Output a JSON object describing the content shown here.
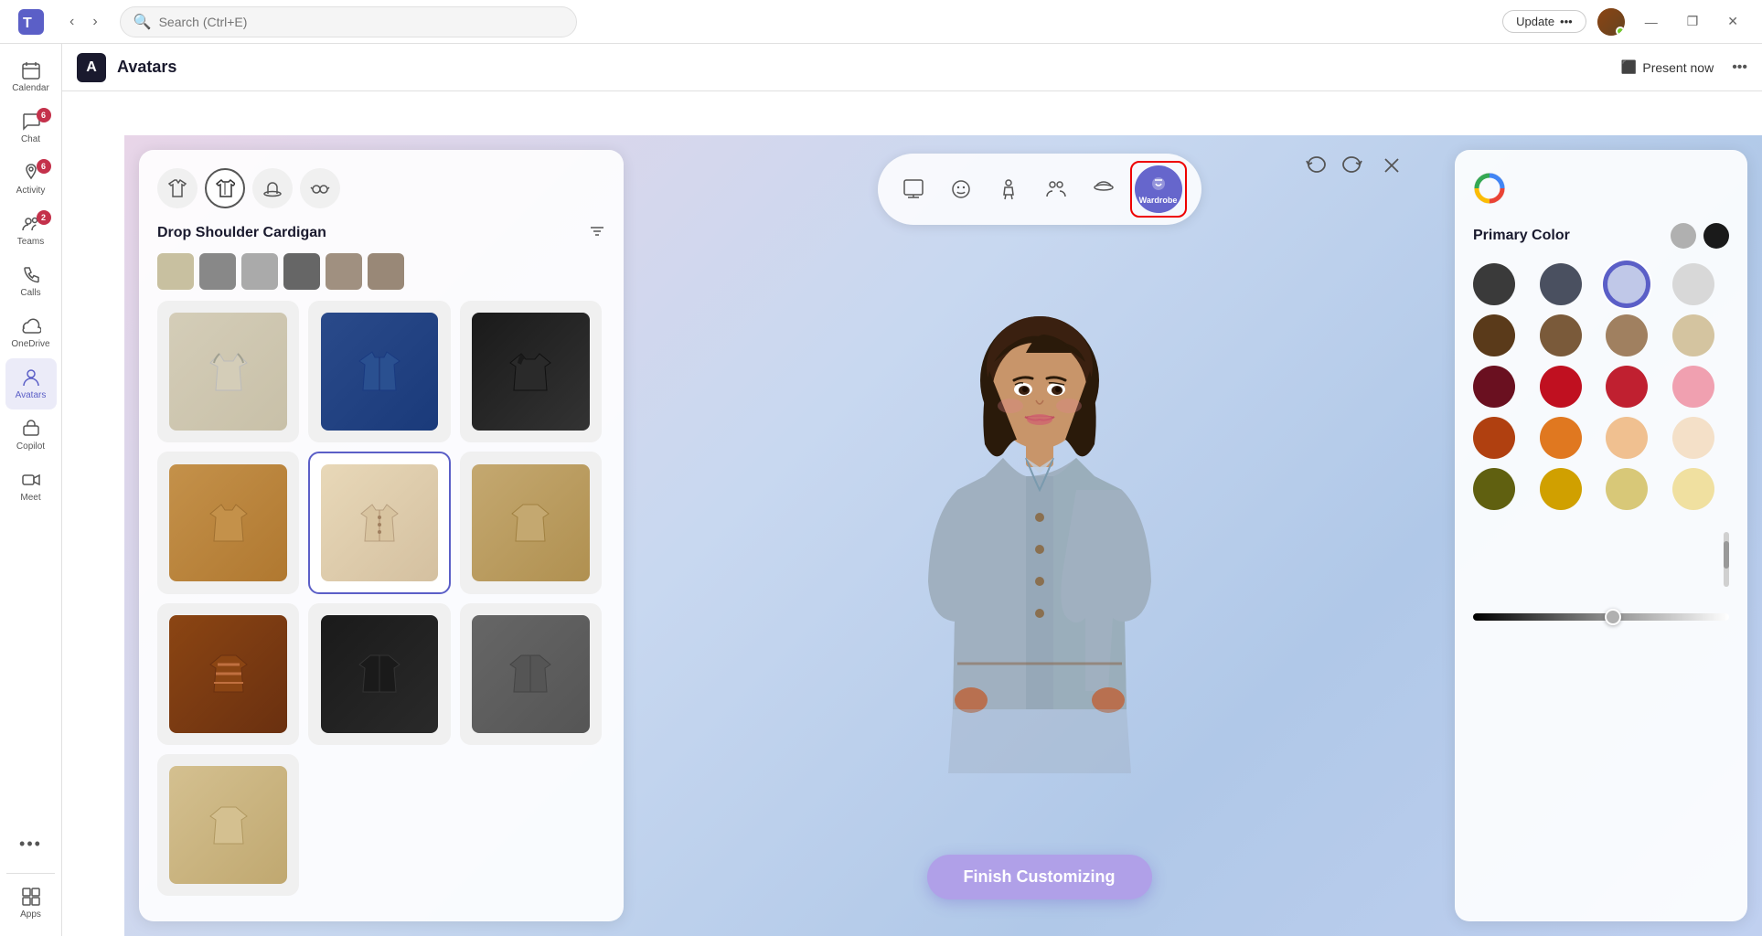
{
  "titlebar": {
    "search_placeholder": "Search (Ctrl+E)",
    "update_label": "Update",
    "update_dots": "•••",
    "minimize_label": "—",
    "maximize_label": "❐",
    "close_label": "✕"
  },
  "sidebar": {
    "items": [
      {
        "id": "calendar",
        "label": "Calendar",
        "icon": "📅",
        "badge": null,
        "active": false
      },
      {
        "id": "chat",
        "label": "Chat",
        "icon": "💬",
        "badge": "6",
        "active": false
      },
      {
        "id": "activity",
        "label": "Activity",
        "icon": "🔔",
        "badge": "6",
        "active": false
      },
      {
        "id": "teams",
        "label": "Teams",
        "icon": "👥",
        "badge": "2",
        "active": false
      },
      {
        "id": "calls",
        "label": "Calls",
        "icon": "📞",
        "badge": null,
        "active": false
      },
      {
        "id": "onedrive",
        "label": "OneDrive",
        "icon": "☁",
        "badge": null,
        "active": false
      },
      {
        "id": "avatars",
        "label": "Avatars",
        "icon": "👤",
        "badge": null,
        "active": true
      },
      {
        "id": "copilot",
        "label": "Copilot",
        "icon": "⚡",
        "badge": null,
        "active": false
      },
      {
        "id": "meet",
        "label": "Meet",
        "icon": "📹",
        "badge": null,
        "active": false
      },
      {
        "id": "more",
        "label": "•••",
        "icon": "•••",
        "badge": null,
        "active": false
      },
      {
        "id": "apps",
        "label": "Apps",
        "icon": "⊞",
        "badge": null,
        "active": false
      }
    ]
  },
  "app": {
    "title": "Avatars",
    "icon_label": "A",
    "present_now_label": "Present now",
    "more_label": "•••"
  },
  "category_toolbar": {
    "buttons": [
      {
        "id": "avatar-select",
        "icon": "🖼",
        "label": "",
        "active": false
      },
      {
        "id": "face",
        "icon": "😊",
        "label": "",
        "active": false
      },
      {
        "id": "body",
        "icon": "🧍",
        "label": "",
        "active": false
      },
      {
        "id": "group",
        "icon": "👥",
        "label": "",
        "active": false
      },
      {
        "id": "accessories",
        "icon": "🎩",
        "label": "",
        "active": false
      },
      {
        "id": "wardrobe",
        "icon": "👕",
        "label": "Wardrobe",
        "active": true
      }
    ],
    "undo_label": "↩",
    "redo_label": "↪",
    "close_label": "✕"
  },
  "wardrobe": {
    "tabs": [
      {
        "id": "shirt",
        "icon": "👔",
        "active": false
      },
      {
        "id": "jacket",
        "icon": "🧥",
        "active": true
      },
      {
        "id": "hat",
        "icon": "🎩",
        "active": false
      },
      {
        "id": "glasses",
        "icon": "👓",
        "active": false
      }
    ],
    "title": "Drop Shoulder Cardigan",
    "filter_icon": "≡",
    "items": [
      {
        "id": 1,
        "color": "#d4cdb8",
        "selected": false,
        "label": "hoodie-beige"
      },
      {
        "id": 2,
        "color": "#2a4a8a",
        "selected": false,
        "label": "jacket-blue"
      },
      {
        "id": 3,
        "color": "#1a1a1a",
        "selected": false,
        "label": "jacket-black"
      },
      {
        "id": 4,
        "color": "#c4914a",
        "selected": false,
        "label": "cardigan-orange"
      },
      {
        "id": 5,
        "color": "#c8a878",
        "selected": true,
        "label": "cardigan-tan"
      },
      {
        "id": 6,
        "color": "#c4a870",
        "selected": false,
        "label": "jacket-khaki"
      },
      {
        "id": 7,
        "color": "#8B4513",
        "selected": false,
        "label": "jacket-plaid"
      },
      {
        "id": 8,
        "color": "#1a1a1a",
        "selected": false,
        "label": "blazer-black"
      },
      {
        "id": 9,
        "color": "#555555",
        "selected": false,
        "label": "blazer-gray"
      },
      {
        "id": 10,
        "color": "#c4a870",
        "selected": false,
        "label": "jacket-beige-2"
      }
    ]
  },
  "color_panel": {
    "title": "Primary Color",
    "presets": [
      {
        "color": "#b0b0b0",
        "selected": false
      },
      {
        "color": "#1a1a1a",
        "selected": false
      }
    ],
    "swatches": [
      {
        "color": "#3a3a3a",
        "row": 0,
        "selected": false
      },
      {
        "color": "#4a5060",
        "row": 0,
        "selected": false
      },
      {
        "color": "#c0c8e8",
        "row": 0,
        "selected": true
      },
      {
        "color": "#d8d8d8",
        "row": 0,
        "selected": false
      },
      {
        "color": "#5a3a1a",
        "row": 1,
        "selected": false
      },
      {
        "color": "#7a5a3a",
        "row": 1,
        "selected": false
      },
      {
        "color": "#a08060",
        "row": 1,
        "selected": false
      },
      {
        "color": "#d4c4a0",
        "row": 1,
        "selected": false
      },
      {
        "color": "#6a1020",
        "row": 2,
        "selected": false
      },
      {
        "color": "#c01020",
        "row": 2,
        "selected": false
      },
      {
        "color": "#c02030",
        "row": 2,
        "selected": false
      },
      {
        "color": "#f0a0b0",
        "row": 2,
        "selected": false
      },
      {
        "color": "#b04010",
        "row": 3,
        "selected": false
      },
      {
        "color": "#e07820",
        "row": 3,
        "selected": false
      },
      {
        "color": "#f0c090",
        "row": 3,
        "selected": false
      },
      {
        "color": "#f4e0c8",
        "row": 3,
        "selected": false
      },
      {
        "color": "#606010",
        "row": 4,
        "selected": false
      },
      {
        "color": "#d0a000",
        "row": 4,
        "selected": false
      },
      {
        "color": "#d8c878",
        "row": 4,
        "selected": false
      },
      {
        "color": "#f0e0a0",
        "row": 4,
        "selected": false
      }
    ],
    "slider_value": 55
  },
  "avatar": {
    "finish_label": "Finish Customizing"
  }
}
